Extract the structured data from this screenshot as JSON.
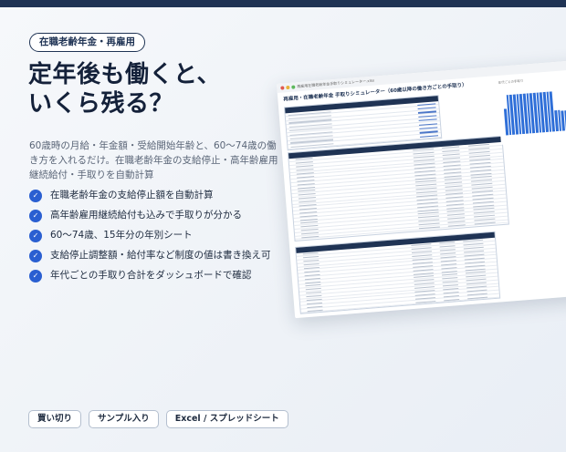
{
  "tag": "在職老齢年金・再雇用",
  "headline": [
    "定年後も働くと、",
    "いくら残る？"
  ],
  "lead": "60歳時の月給・年金額・受給開始年齢と、60〜74歳の働き方を入れるだけ。在職老齢年金の支給停止・高年齢雇用継続給付・手取りを自動計算",
  "features": [
    "在職老齢年金の支給停止額を自動計算",
    "高年齢雇用継続給付も込みで手取りが分かる",
    "60〜74歳、15年分の年別シート",
    "支給停止調整額・給付率など制度の値は書き換え可",
    "年代ごとの手取り合計をダッシュボードで確認"
  ],
  "pills": [
    "買い切り",
    "サンプル入り",
    "Excel / スプレッドシート"
  ],
  "sheet": {
    "file": "再雇用在職老齢年金手取りシミュレーター.xlsx",
    "title": "再雇用・在職老齢年金 手取りシミュレーター（60歳以降の働き方ごとの手取り）",
    "chart_title": "年代ごとの手取り",
    "bars": [
      0.55,
      0.85,
      0.85,
      0.85,
      0.85,
      0.85,
      0.85,
      0.85,
      0.85,
      0.85,
      0.85,
      0.85,
      0.85,
      0.85,
      0.85,
      0.45,
      0.45,
      0.42,
      0.42,
      0.42,
      0.42,
      0.42,
      0.42,
      0.28,
      0.28,
      0.28,
      0.28,
      0.28
    ]
  },
  "colors": {
    "navy": "#1f3354",
    "accent": "#2a5fd1"
  }
}
